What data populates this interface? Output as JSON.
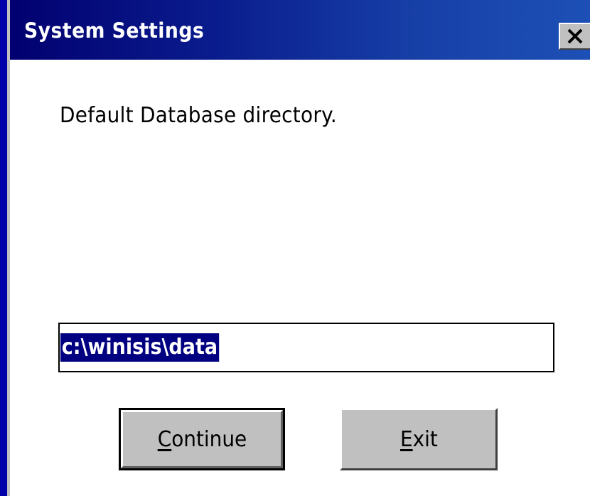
{
  "window": {
    "title": "System Settings"
  },
  "titlebar": {
    "close_icon": "close-icon"
  },
  "dialog": {
    "prompt": "Default Database directory.",
    "directory_value": "c:\\winisis\\data",
    "directory_selected": true
  },
  "buttons": {
    "continue": {
      "mnemonic": "C",
      "rest": "ontinue",
      "default": true
    },
    "exit": {
      "mnemonic": "E",
      "rest": "xit"
    }
  },
  "colors": {
    "desktop": "#0000a8",
    "titlebar_start": "#020070",
    "titlebar_end": "#1d50b6",
    "selection": "#000080",
    "face": "#c0c0c0"
  }
}
